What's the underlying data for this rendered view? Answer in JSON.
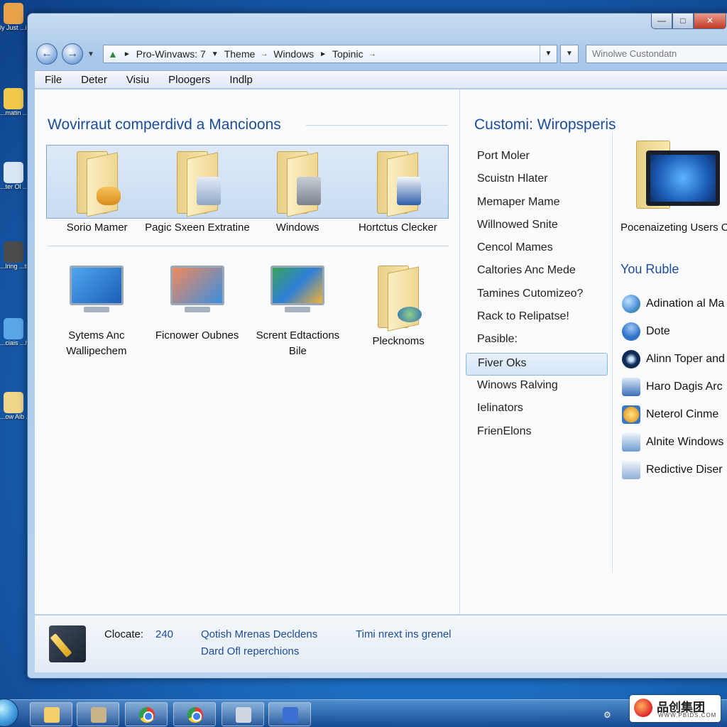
{
  "desktop": {
    "items": [
      {
        "label": "ly Just ...ippen",
        "icon": "user-folder-icon",
        "color": "#e8a34a"
      },
      {
        "label": "...matin ...gna",
        "icon": "document-icon",
        "color": "#f2c94c"
      },
      {
        "label": "...ter Ol ...su",
        "icon": "app-icon",
        "color": "#d9e6f5"
      },
      {
        "label": "...lring ...tima",
        "icon": "gauge-icon",
        "color": "#4b4b4b"
      },
      {
        "label": "...ciais ...hel",
        "icon": "network-icon",
        "color": "#5aa6e8"
      },
      {
        "label": "...ow Aib ...Bille",
        "icon": "folder-icon",
        "color": "#f0d68a"
      }
    ]
  },
  "window": {
    "caption_buttons": {
      "minimize": "—",
      "maximize": "□",
      "close": "✕"
    }
  },
  "nav": {
    "back_icon": "back-arrow-icon",
    "forward_icon": "forward-arrow-icon",
    "address_segments": [
      "Pro-Winvaws: 7",
      "Theme",
      "Windows",
      "Topinic"
    ],
    "search_placeholder": "Winolwe Custondatn"
  },
  "menu": {
    "items": [
      "File",
      "Deter",
      "Visiu",
      "Ploogers",
      "Indlp"
    ]
  },
  "left_pane": {
    "title": "Wovirraut comperdivd a Mancioons",
    "row1": [
      {
        "label": "Sorio Mamer",
        "icon": "folder-notepad-icon"
      },
      {
        "label": "Pagic Sxeen Extratine",
        "icon": "folder-tools-icon"
      },
      {
        "label": "Windows",
        "icon": "folder-calculator-icon"
      },
      {
        "label": "Hortctus Clecker",
        "icon": "folder-book-icon"
      }
    ],
    "row2": [
      {
        "label": "Sytems Anc Wallipechem",
        "icon": "monitor-wallpaper-icon"
      },
      {
        "label": "Ficnower Oubnes",
        "icon": "monitor-cursor-icon"
      },
      {
        "label": "Scrent Edtactions Bile",
        "icon": "monitor-checkmark-icon"
      },
      {
        "label": "Plecknoms",
        "icon": "folder-device-icon"
      }
    ]
  },
  "right_pane": {
    "title": "Customi: Wiropsperis",
    "nav_items": [
      "Port Moler",
      "Scuistn Hlater",
      "Memaper Mame",
      "Willnowed Snite",
      "Cencol Mames",
      "Caltories Anc Mede",
      "Tamines Cutomizeo?",
      "Rack to Relipatse!",
      "Pasible:",
      "Fiver Oks",
      "Winows Ralving",
      "Ielinators",
      "FrienElons"
    ],
    "selected_index": 9,
    "preview_label": "Pocenaizeting Users Cineck",
    "subtitle": "You Ruble",
    "links": [
      {
        "label": "Adination al Ma",
        "icon": "globe-icon",
        "color": "#4a8fd6"
      },
      {
        "label": "Dote",
        "icon": "user-icon",
        "color": "#2f72c8"
      },
      {
        "label": "Alinn Toper and",
        "icon": "camera-icon",
        "color": "#0f2b55"
      },
      {
        "label": "Haro Dagis Arc",
        "icon": "people-icon",
        "color": "#3a6fb8"
      },
      {
        "label": "Neterol Cinme",
        "icon": "sun-icon",
        "color": "#e9a22c"
      },
      {
        "label": "Alnite Windows",
        "icon": "window-icon",
        "color": "#6f9bd1"
      },
      {
        "label": "Redictive Diser",
        "icon": "display-icon",
        "color": "#8fb0d8"
      }
    ]
  },
  "status": {
    "col1_line1": "Clocate:",
    "col1_value": "240",
    "col2_line1": "Qotish Mrenas Decldens",
    "col2_line2": "Dard Ofl reperchions",
    "col3_line1": "Timi nrext ins grenel"
  },
  "taskbar": {
    "buttons": [
      {
        "icon": "explorer-icon",
        "color": "#f2cf6a"
      },
      {
        "icon": "image-viewer-icon",
        "color": "#c9b38b"
      },
      {
        "icon": "chrome-icon",
        "color": "chrome"
      },
      {
        "icon": "chrome-icon",
        "color": "chrome"
      },
      {
        "icon": "paint-icon",
        "color": "#cfd8e2"
      },
      {
        "icon": "remote-desktop-icon",
        "color": "#3b6fd1"
      }
    ],
    "tray_glyph": "⚙"
  },
  "watermark": {
    "title": "品创集团",
    "subtitle": "WWW.PBIDS.COM"
  }
}
